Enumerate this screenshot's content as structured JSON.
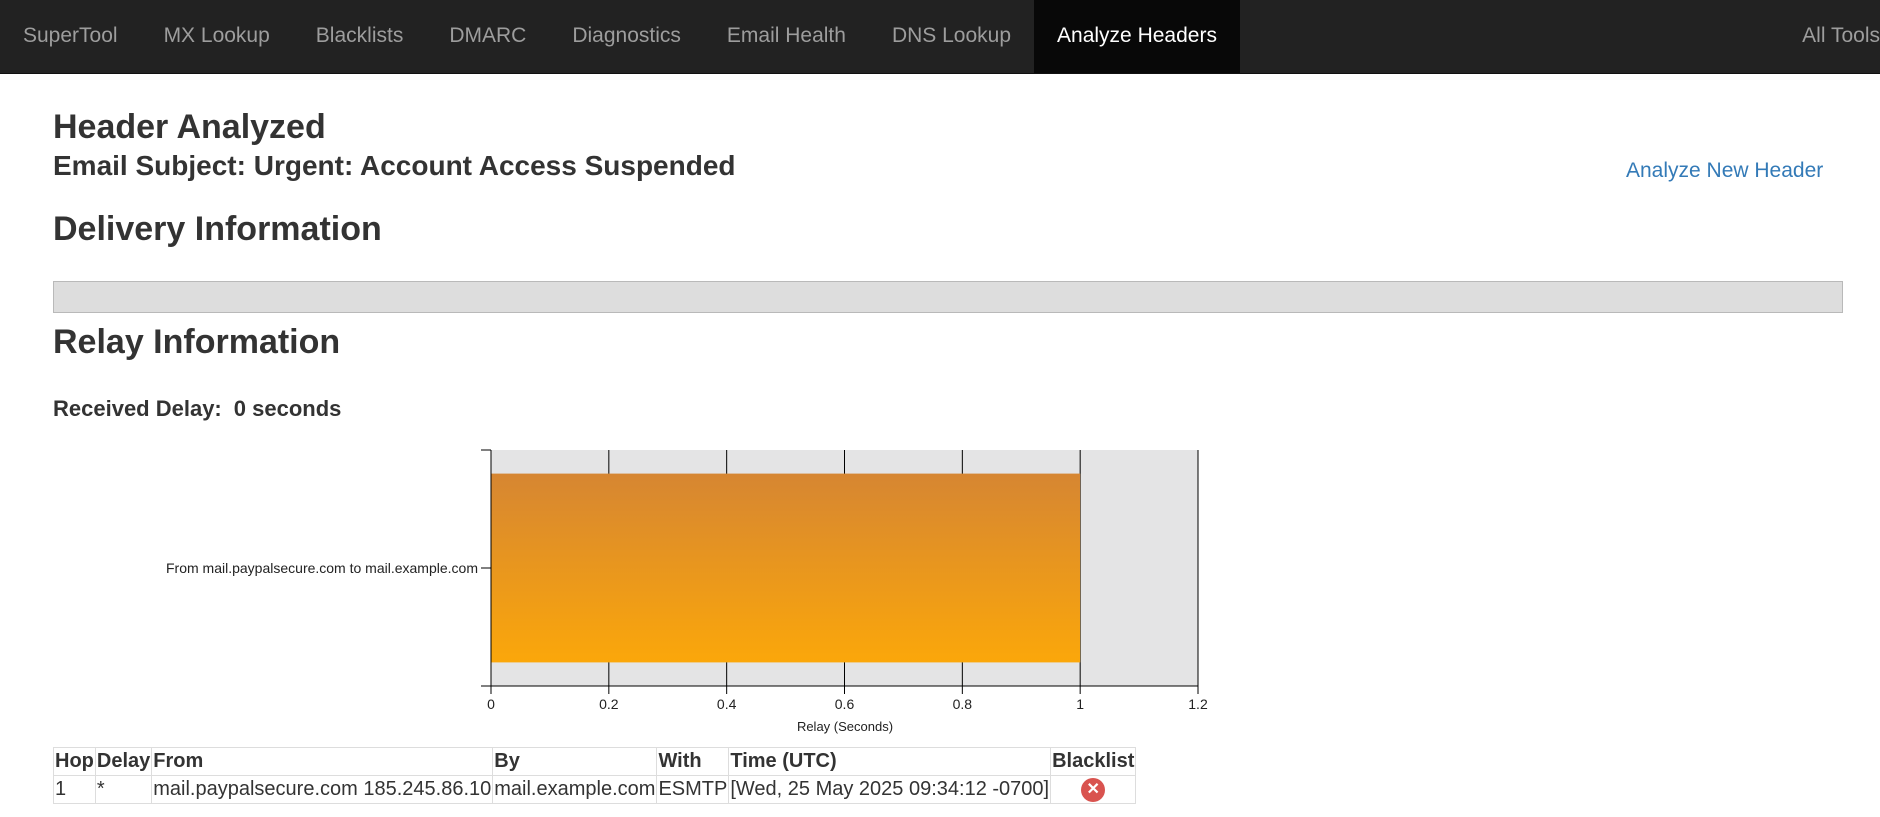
{
  "nav": {
    "items": [
      {
        "label": "SuperTool"
      },
      {
        "label": "MX Lookup"
      },
      {
        "label": "Blacklists"
      },
      {
        "label": "DMARC"
      },
      {
        "label": "Diagnostics"
      },
      {
        "label": "Email Health"
      },
      {
        "label": "DNS Lookup"
      },
      {
        "label": "Analyze Headers",
        "active": true
      }
    ],
    "right_label": "All Tools"
  },
  "header": {
    "title": "Header Analyzed",
    "subject": "Email Subject: Urgent: Account Access Suspended",
    "analyze_new_label": "Analyze New Header"
  },
  "delivery": {
    "title": "Delivery Information"
  },
  "relay": {
    "title": "Relay Information",
    "received_delay_label": "Received Delay:",
    "received_delay_value": "0 seconds"
  },
  "chart_data": {
    "type": "bar",
    "orientation": "horizontal",
    "categories": [
      "From mail.paypalsecure.com to mail.example.com"
    ],
    "values": [
      1
    ],
    "xlabel": "Relay (Seconds)",
    "xlim": [
      0,
      1.2
    ],
    "xticks": [
      "0",
      "0.2",
      "0.4",
      "0.6",
      "0.8",
      "1",
      "1.2"
    ],
    "grid": true,
    "colors": {
      "bar_top": "#d68632",
      "bar_bottom": "#fba70a",
      "plot_bg": "#e4e4e5"
    }
  },
  "table": {
    "headers": [
      "Hop",
      "Delay",
      "From",
      "By",
      "With",
      "Time (UTC)",
      "Blacklist"
    ],
    "rows": [
      [
        "1",
        "*",
        "mail.paypalsecure.com 185.245.86.10",
        "mail.example.com",
        "ESMTP",
        "[Wed, 25 May 2025 09:34:12 -0700]"
      ]
    ],
    "blacklist_icon": "close-circle-icon"
  }
}
